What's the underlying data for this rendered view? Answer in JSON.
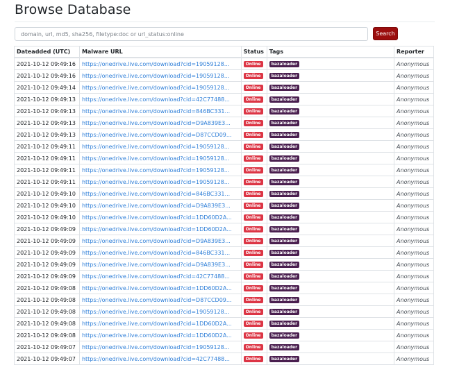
{
  "page": {
    "title": "Browse Database"
  },
  "search": {
    "placeholder": "domain, url, md5, sha256, filetype:doc or url_status:online",
    "value": "",
    "button_label": "Search"
  },
  "colors": {
    "accent": "#9b0e0e",
    "online_badge": "#dc3545",
    "tag_badge": "#4a1f4f",
    "link": "#2f7fd8"
  },
  "table": {
    "headers": [
      "Dateadded (UTC)",
      "Malware URL",
      "Status",
      "Tags",
      "Reporter"
    ],
    "rows": [
      {
        "date": "2021-10-12 09:49:16",
        "url": "https://onedrive.live.com/download?cid=19059128...",
        "status": "Online",
        "tag": "bazaloader",
        "reporter": "Anonymous"
      },
      {
        "date": "2021-10-12 09:49:16",
        "url": "https://onedrive.live.com/download?cid=19059128...",
        "status": "Online",
        "tag": "bazaloader",
        "reporter": "Anonymous"
      },
      {
        "date": "2021-10-12 09:49:14",
        "url": "https://onedrive.live.com/download?cid=19059128...",
        "status": "Online",
        "tag": "bazaloader",
        "reporter": "Anonymous"
      },
      {
        "date": "2021-10-12 09:49:13",
        "url": "https://onedrive.live.com/download?cid=42C77488...",
        "status": "Online",
        "tag": "bazaloader",
        "reporter": "Anonymous"
      },
      {
        "date": "2021-10-12 09:49:13",
        "url": "https://onedrive.live.com/download?cid=846BC331...",
        "status": "Online",
        "tag": "bazaloader",
        "reporter": "Anonymous"
      },
      {
        "date": "2021-10-12 09:49:13",
        "url": "https://onedrive.live.com/download?cid=D9A839E3...",
        "status": "Online",
        "tag": "bazaloader",
        "reporter": "Anonymous"
      },
      {
        "date": "2021-10-12 09:49:13",
        "url": "https://onedrive.live.com/download?cid=D87CCD09...",
        "status": "Online",
        "tag": "bazaloader",
        "reporter": "Anonymous"
      },
      {
        "date": "2021-10-12 09:49:11",
        "url": "https://onedrive.live.com/download?cid=19059128...",
        "status": "Online",
        "tag": "bazaloader",
        "reporter": "Anonymous"
      },
      {
        "date": "2021-10-12 09:49:11",
        "url": "https://onedrive.live.com/download?cid=19059128...",
        "status": "Online",
        "tag": "bazaloader",
        "reporter": "Anonymous"
      },
      {
        "date": "2021-10-12 09:49:11",
        "url": "https://onedrive.live.com/download?cid=19059128...",
        "status": "Online",
        "tag": "bazaloader",
        "reporter": "Anonymous"
      },
      {
        "date": "2021-10-12 09:49:11",
        "url": "https://onedrive.live.com/download?cid=19059128...",
        "status": "Online",
        "tag": "bazaloader",
        "reporter": "Anonymous"
      },
      {
        "date": "2021-10-12 09:49:10",
        "url": "https://onedrive.live.com/download?cid=846BC331...",
        "status": "Online",
        "tag": "bazaloader",
        "reporter": "Anonymous"
      },
      {
        "date": "2021-10-12 09:49:10",
        "url": "https://onedrive.live.com/download?cid=D9A839E3...",
        "status": "Online",
        "tag": "bazaloader",
        "reporter": "Anonymous"
      },
      {
        "date": "2021-10-12 09:49:10",
        "url": "https://onedrive.live.com/download?cid=1DD60D2A...",
        "status": "Online",
        "tag": "bazaloader",
        "reporter": "Anonymous"
      },
      {
        "date": "2021-10-12 09:49:09",
        "url": "https://onedrive.live.com/download?cid=1DD60D2A...",
        "status": "Online",
        "tag": "bazaloader",
        "reporter": "Anonymous"
      },
      {
        "date": "2021-10-12 09:49:09",
        "url": "https://onedrive.live.com/download?cid=D9A839E3...",
        "status": "Online",
        "tag": "bazaloader",
        "reporter": "Anonymous"
      },
      {
        "date": "2021-10-12 09:49:09",
        "url": "https://onedrive.live.com/download?cid=846BC331...",
        "status": "Online",
        "tag": "bazaloader",
        "reporter": "Anonymous"
      },
      {
        "date": "2021-10-12 09:49:09",
        "url": "https://onedrive.live.com/download?cid=D9A839E3...",
        "status": "Online",
        "tag": "bazaloader",
        "reporter": "Anonymous"
      },
      {
        "date": "2021-10-12 09:49:09",
        "url": "https://onedrive.live.com/download?cid=42C77488...",
        "status": "Online",
        "tag": "bazaloader",
        "reporter": "Anonymous"
      },
      {
        "date": "2021-10-12 09:49:08",
        "url": "https://onedrive.live.com/download?cid=1DD60D2A...",
        "status": "Online",
        "tag": "bazaloader",
        "reporter": "Anonymous"
      },
      {
        "date": "2021-10-12 09:49:08",
        "url": "https://onedrive.live.com/download?cid=D87CCD09...",
        "status": "Online",
        "tag": "bazaloader",
        "reporter": "Anonymous"
      },
      {
        "date": "2021-10-12 09:49:08",
        "url": "https://onedrive.live.com/download?cid=19059128...",
        "status": "Online",
        "tag": "bazaloader",
        "reporter": "Anonymous"
      },
      {
        "date": "2021-10-12 09:49:08",
        "url": "https://onedrive.live.com/download?cid=1DD60D2A...",
        "status": "Online",
        "tag": "bazaloader",
        "reporter": "Anonymous"
      },
      {
        "date": "2021-10-12 09:49:08",
        "url": "https://onedrive.live.com/download?cid=1DD60D2A...",
        "status": "Online",
        "tag": "bazaloader",
        "reporter": "Anonymous"
      },
      {
        "date": "2021-10-12 09:49:07",
        "url": "https://onedrive.live.com/download?cid=19059128...",
        "status": "Online",
        "tag": "bazaloader",
        "reporter": "Anonymous"
      },
      {
        "date": "2021-10-12 09:49:07",
        "url": "https://onedrive.live.com/download?cid=42C77488...",
        "status": "Online",
        "tag": "bazaloader",
        "reporter": "Anonymous"
      }
    ]
  }
}
